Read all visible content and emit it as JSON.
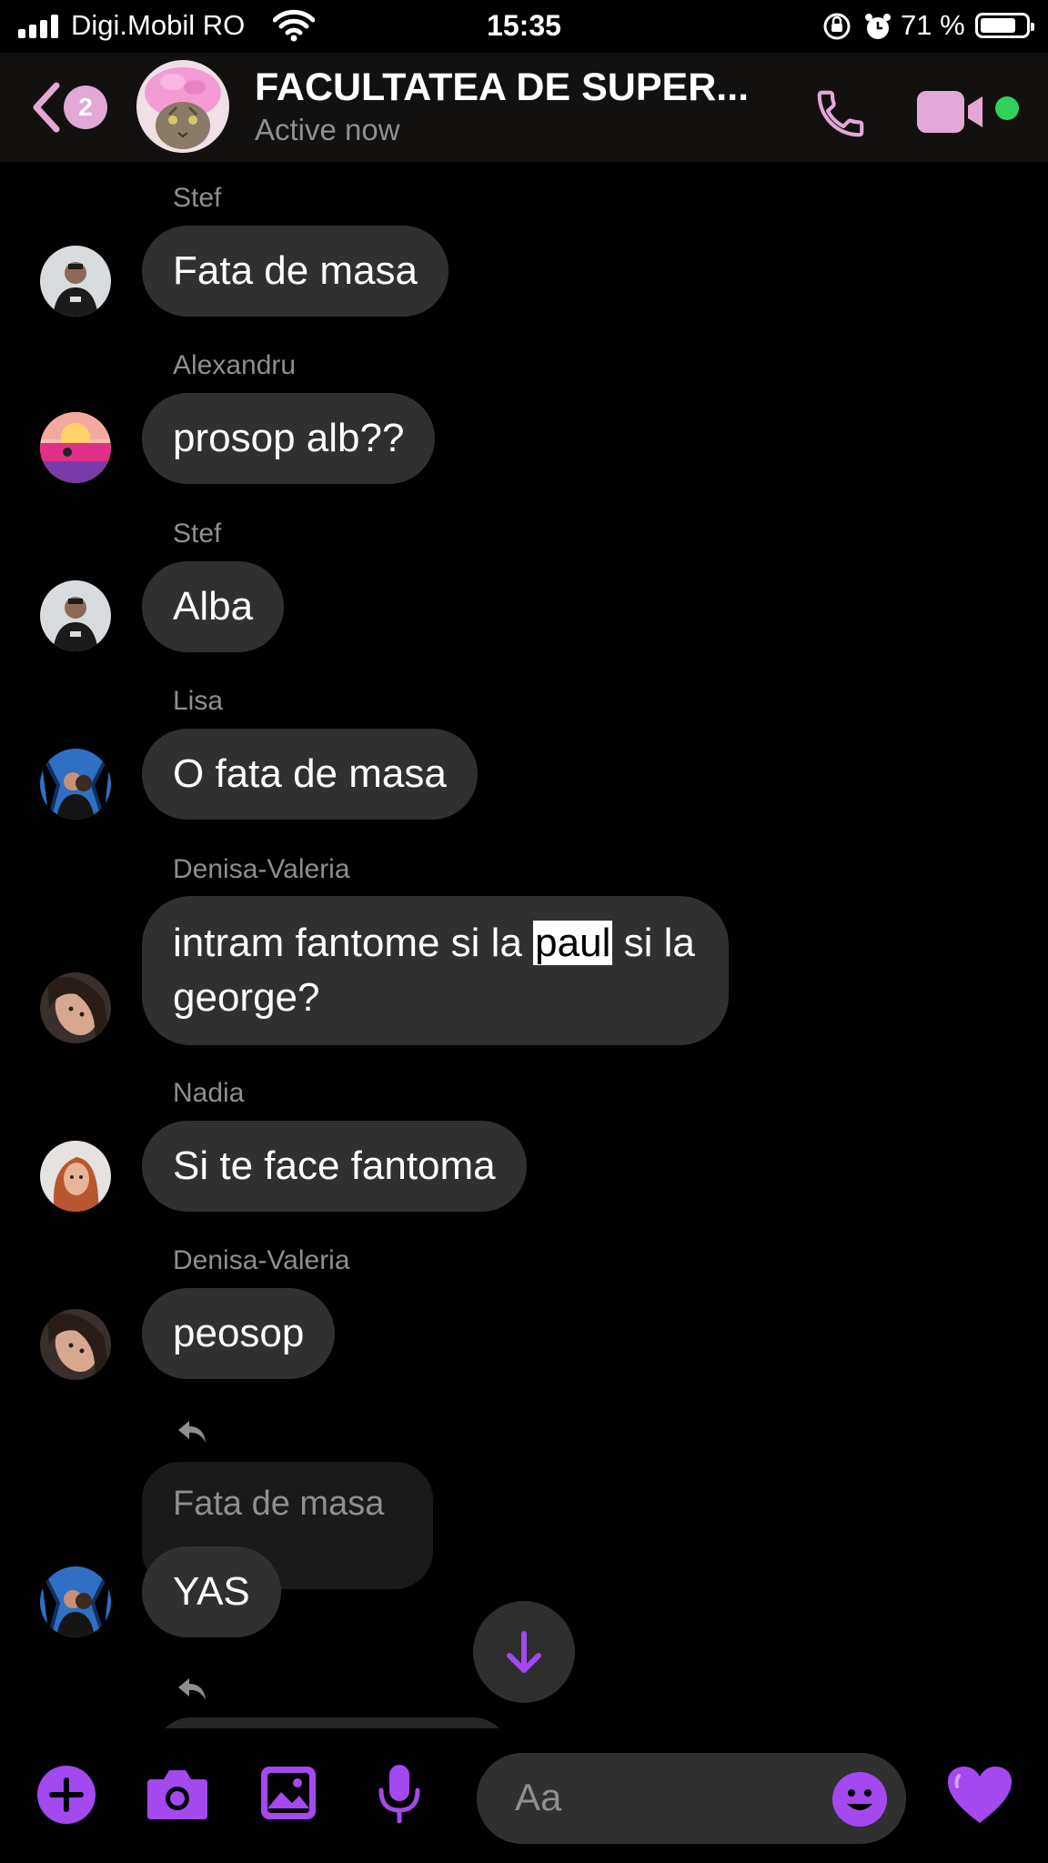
{
  "status_bar": {
    "carrier": "Digi.Mobil RO",
    "time": "15:35",
    "battery": "71 %"
  },
  "header": {
    "back_badge": "2",
    "title": "FACULTATEA DE SUPER...",
    "subtitle": "Active now",
    "accent_color": "#e3a8d6"
  },
  "messages": [
    {
      "sender": "Stef",
      "text": "Fata de masa"
    },
    {
      "sender": "Alexandru",
      "text": "prosop alb??"
    },
    {
      "sender": "Stef",
      "text": "Alba"
    },
    {
      "sender": "Lisa",
      "text": "O fata de masa"
    },
    {
      "sender": "Denisa-Valeria",
      "text_before": "intram fantome si la ",
      "text_highlight": "paul",
      "text_after": " si la george?"
    },
    {
      "sender": "Nadia",
      "text": "Si te face fantoma"
    },
    {
      "sender": "Denisa-Valeria",
      "text": "peosop"
    },
    {
      "quoted": "Fata de masa",
      "text": "YAS"
    }
  ],
  "composer": {
    "placeholder": "Aa",
    "icons": [
      "plus-icon",
      "camera-icon",
      "image-icon",
      "microphone-icon",
      "emoji-icon",
      "heart-icon"
    ],
    "accent_color": "#a448f0"
  }
}
